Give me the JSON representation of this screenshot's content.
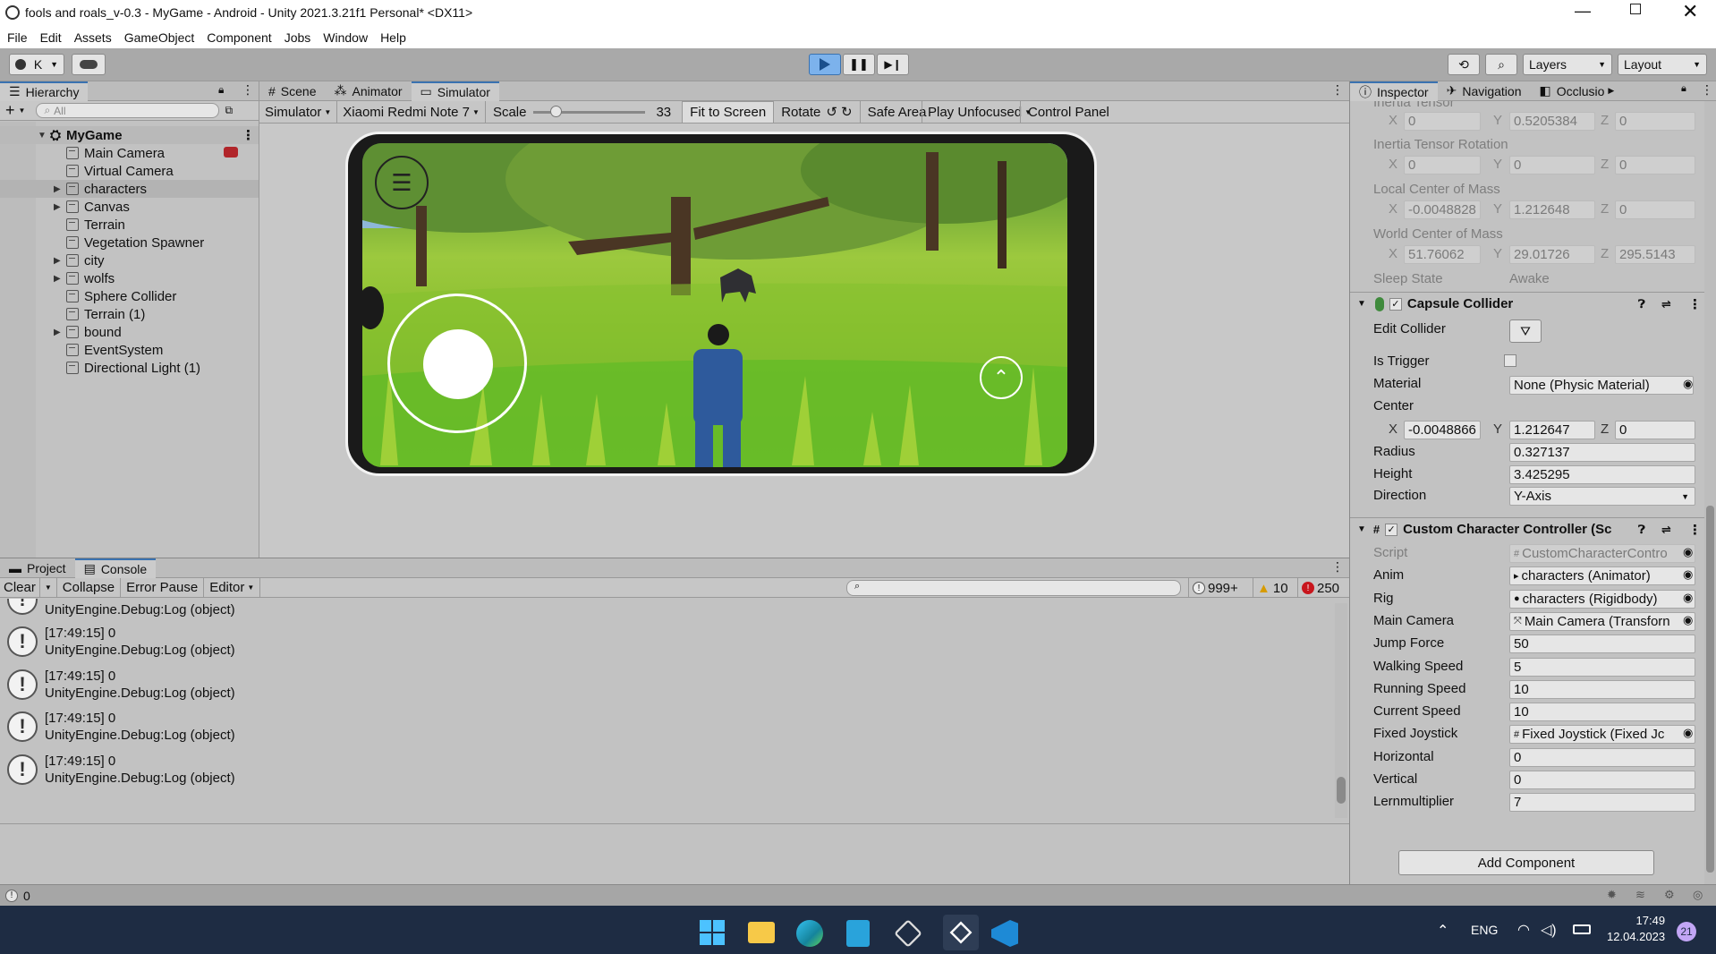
{
  "window": {
    "title": "fools and roals_v-0.3 - MyGame - Android - Unity 2021.3.21f1 Personal* <DX11>"
  },
  "menu": [
    "File",
    "Edit",
    "Assets",
    "GameObject",
    "Component",
    "Jobs",
    "Window",
    "Help"
  ],
  "toolbar": {
    "account": "K",
    "layers": "Layers",
    "layout": "Layout"
  },
  "hierarchy": {
    "tab": "Hierarchy",
    "search_placeholder": "All",
    "root": "MyGame",
    "items": [
      {
        "label": "Main Camera",
        "expandable": false
      },
      {
        "label": "Virtual Camera",
        "expandable": false
      },
      {
        "label": "characters",
        "expandable": true
      },
      {
        "label": "Canvas",
        "expandable": true
      },
      {
        "label": "Terrain",
        "expandable": false
      },
      {
        "label": "Vegetation Spawner",
        "expandable": false
      },
      {
        "label": "city",
        "expandable": true
      },
      {
        "label": "wolfs",
        "expandable": true
      },
      {
        "label": "Sphere Collider",
        "expandable": false
      },
      {
        "label": "Terrain (1)",
        "expandable": false
      },
      {
        "label": "bound",
        "expandable": true
      },
      {
        "label": "EventSystem",
        "expandable": false
      },
      {
        "label": "Directional Light (1)",
        "expandable": false
      }
    ]
  },
  "scene_tabs": [
    "Scene",
    "Animator",
    "Simulator"
  ],
  "simulator": {
    "mode": "Simulator",
    "device": "Xiaomi Redmi Note 7",
    "scale_label": "Scale",
    "scale_value": "33",
    "scale_fraction": 0.2,
    "fit": "Fit to Screen",
    "rotate": "Rotate",
    "safe_area": "Safe Area",
    "play_mode": "Play Unfocused",
    "control_panel": "Control Panel"
  },
  "console": {
    "tabs": [
      "Project",
      "Console"
    ],
    "clear": "Clear",
    "collapse": "Collapse",
    "error_pause": "Error Pause",
    "editor": "Editor",
    "count_log": "999+",
    "count_warn": "10",
    "count_error": "250",
    "partial_line": "UnityEngine.Debug:Log (object)",
    "entries": [
      {
        "time": "[17:49:15] 0",
        "msg": "UnityEngine.Debug:Log (object)"
      },
      {
        "time": "[17:49:15] 0",
        "msg": "UnityEngine.Debug:Log (object)"
      },
      {
        "time": "[17:49:15] 0",
        "msg": "UnityEngine.Debug:Log (object)"
      },
      {
        "time": "[17:49:15] 0",
        "msg": "UnityEngine.Debug:Log (object)"
      }
    ]
  },
  "inspector": {
    "tabs": [
      "Inspector",
      "Navigation",
      "Occlusio"
    ],
    "rigidbody": {
      "inertia_tensor_label": "Inertia Tensor",
      "it_x": "0",
      "it_y": "0.5205384",
      "it_z": "0",
      "inertia_rot_label": "Inertia Tensor Rotation",
      "ir_x": "0",
      "ir_y": "0",
      "ir_z": "0",
      "local_com_label": "Local Center of Mass",
      "lc_x": "-0.0048828",
      "lc_y": "1.212648",
      "lc_z": "0",
      "world_com_label": "World Center of Mass",
      "wc_x": "51.76062",
      "wc_y": "29.01726",
      "wc_z": "295.5143",
      "sleep_label": "Sleep State",
      "sleep_value": "Awake"
    },
    "capsule": {
      "title": "Capsule Collider",
      "edit_collider": "Edit Collider",
      "is_trigger": "Is Trigger",
      "material_label": "Material",
      "material_value": "None (Physic Material)",
      "center_label": "Center",
      "c_x": "-0.0048866",
      "c_y": "1.212647",
      "c_z": "0",
      "radius_label": "Radius",
      "radius": "0.327137",
      "height_label": "Height",
      "height": "3.425295",
      "direction_label": "Direction",
      "direction": "Y-Axis"
    },
    "controller": {
      "title": "Custom Character Controller (Sc",
      "fields": [
        {
          "label": "Script",
          "value": "CustomCharacterContro",
          "disabled": true
        },
        {
          "label": "Anim",
          "value": "characters (Animator)"
        },
        {
          "label": "Rig",
          "value": "characters (Rigidbody)"
        },
        {
          "label": "Main Camera",
          "value": "Main Camera (Transforn"
        },
        {
          "label": "Jump Force",
          "value": "50"
        },
        {
          "label": "Walking Speed",
          "value": "5"
        },
        {
          "label": "Running Speed",
          "value": "10"
        },
        {
          "label": "Current Speed",
          "value": "10"
        },
        {
          "label": "Fixed Joystick",
          "value": "Fixed Joystick (Fixed Jc"
        },
        {
          "label": "Horizontal",
          "value": "0"
        },
        {
          "label": "Vertical",
          "value": "0"
        },
        {
          "label": "Lernmultiplier",
          "value": "7"
        }
      ]
    },
    "add_component": "Add Component"
  },
  "status": {
    "count": "0"
  },
  "taskbar": {
    "lang": "ENG",
    "time": "17:49",
    "date": "12.04.2023",
    "badge": "21"
  },
  "colors": {
    "accent": "#3a72b0",
    "taskbar": "#1e2c43",
    "grass": "#7fc23a"
  }
}
